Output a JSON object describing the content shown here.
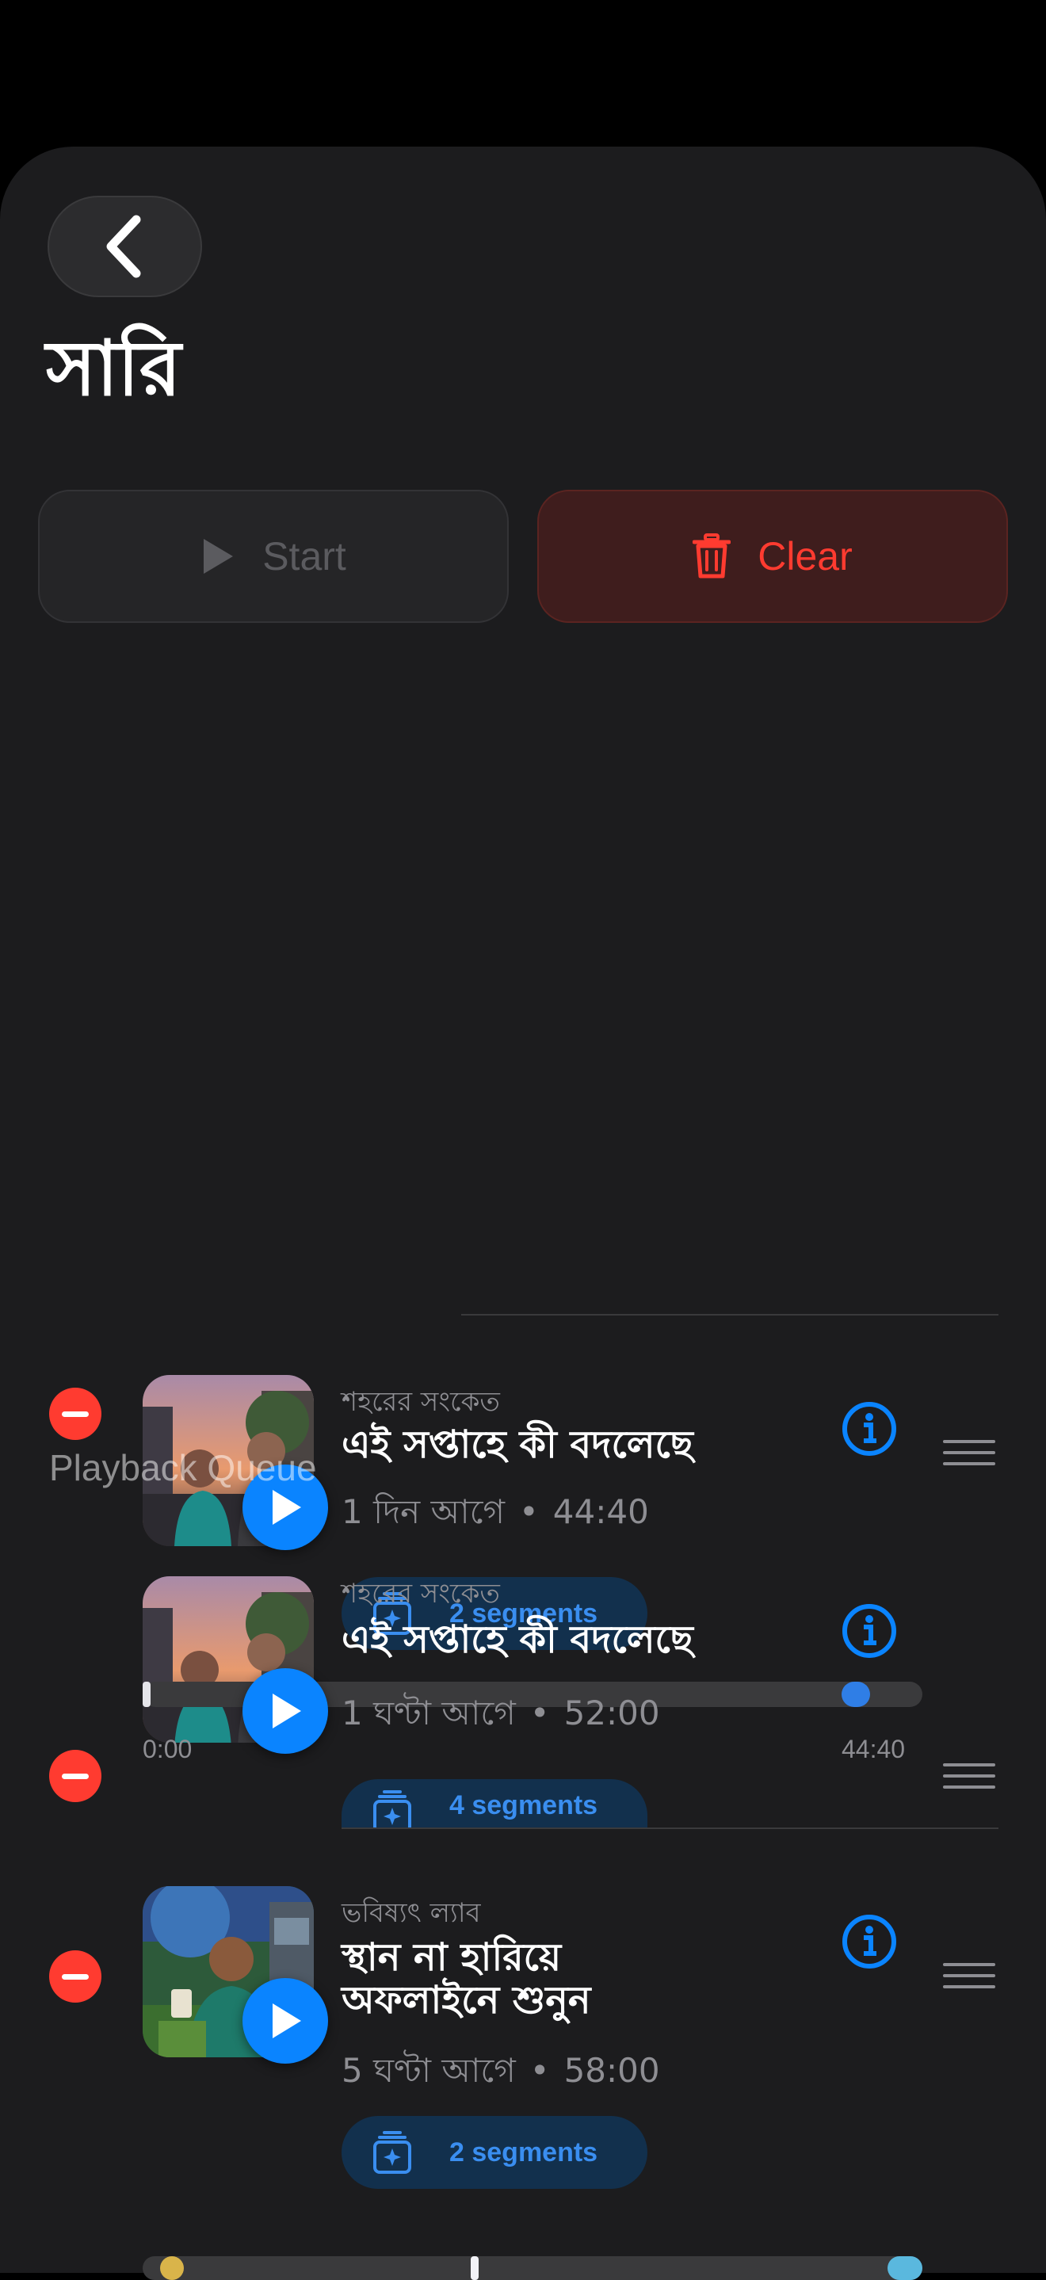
{
  "header": {
    "title": "সারি"
  },
  "actions": {
    "start_label": "Start",
    "clear_label": "Clear"
  },
  "overlay": {
    "label": "Playback Queue"
  },
  "queue": [
    {
      "show": "শহরের সংকেত",
      "title": "এই সপ্তাহে কী বদলেছে",
      "age": "1 দিন আগে",
      "duration": "44:40",
      "segments": "2 segments"
    },
    {
      "show": "শহরের সংকেত",
      "title": "এই সপ্তাহে কী বদলেছে",
      "age": "1 ঘণ্টা আগে",
      "duration": "52:00",
      "segments": "4 segments",
      "progress": {
        "start": "0:00",
        "end": "44:40",
        "fraction": 0.93
      }
    },
    {
      "show": "ভবিষ্যৎ ল্যাব",
      "title_line1": "স্থান না হারিয়ে",
      "title_line2": "অফলাইনে শুনুন",
      "age": "5 ঘণ্টা আগে",
      "duration": "58:00",
      "segments": "2 segments"
    }
  ],
  "separator": "•",
  "colors": {
    "accent": "#0a84ff",
    "destructive": "#ff3b30",
    "background": "#1c1c1e"
  },
  "icons": [
    "chevron-left-icon",
    "play-icon",
    "trash-icon",
    "minus-icon",
    "info-icon",
    "drag-handle-icon",
    "segments-icon"
  ]
}
